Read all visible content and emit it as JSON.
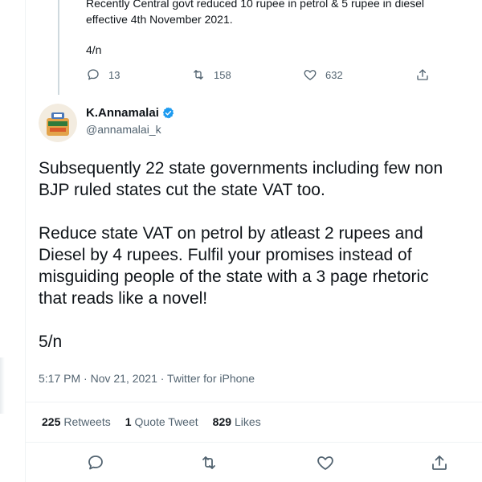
{
  "previous_tweet": {
    "text_line1": "Recently Central govt  reduced 10 rupee in petrol & 5 rupee in diesel",
    "text_line2": "effective 4th November 2021.",
    "thread_count": "4/n",
    "reply_count": "13",
    "retweet_count": "158",
    "like_count": "632"
  },
  "tweet": {
    "author_name": "K.Annamalai",
    "author_handle": "@annamalai_k",
    "paragraph1_line1": "Subsequently 22 state governments including few non",
    "paragraph1_line2": "BJP ruled states cut the state VAT too.",
    "paragraph2_line1": "Reduce state VAT on petrol by atleast 2 rupees and",
    "paragraph2_line2": "Diesel by 4 rupees. Fulfil your promises instead of",
    "paragraph2_line3": "misguiding people of the state with a 3 page rhetoric",
    "paragraph2_line4": "that reads like a novel!",
    "thread_count": "5/n",
    "timestamp": "5:17 PM · Nov 21, 2021 · Twitter for iPhone"
  },
  "stats": {
    "retweets_count": "225",
    "retweets_label": "Retweets",
    "quote_count": "1",
    "quote_label": "Quote Tweet",
    "likes_count": "829",
    "likes_label": "Likes"
  },
  "icons": {
    "reply": "reply-icon",
    "retweet": "retweet-icon",
    "like": "like-icon",
    "share": "share-icon",
    "verified": "verified-badge-icon"
  },
  "colors": {
    "text": "#0f1419",
    "secondary": "#536471",
    "verified": "#1d9bf0",
    "divider": "#eff3f4"
  }
}
